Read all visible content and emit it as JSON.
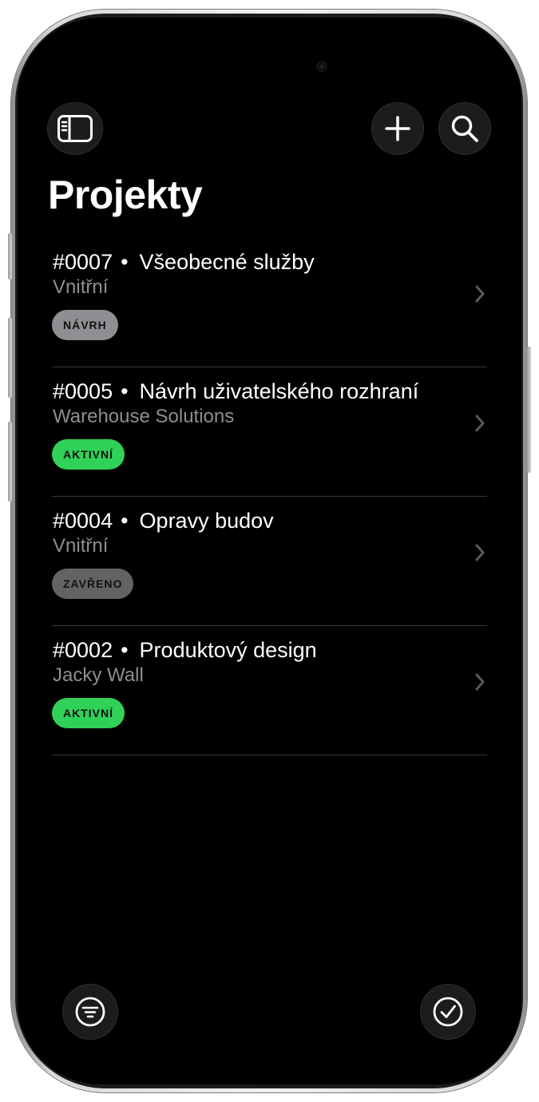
{
  "header": {
    "title": "Projekty",
    "icons": {
      "sidebar": "sidebar-icon",
      "add": "plus-icon",
      "search": "search-icon"
    }
  },
  "projects": [
    {
      "number": "#0007",
      "separator": "•",
      "name": "Všeobecné služby",
      "client": "Vnitřní",
      "status": "NÁVRH",
      "status_color": "#8e8e93"
    },
    {
      "number": "#0005",
      "separator": "•",
      "name": "Návrh uživatelského rozhraní",
      "client": "Warehouse Solutions",
      "status": "AKTIVNÍ",
      "status_color": "#30d158"
    },
    {
      "number": "#0004",
      "separator": "•",
      "name": "Opravy budov",
      "client": "Vnitřní",
      "status": "ZAVŘENO",
      "status_color": "#636366"
    },
    {
      "number": "#0002",
      "separator": "•",
      "name": "Produktový design",
      "client": "Jacky Wall",
      "status": "AKTIVNÍ",
      "status_color": "#30d158"
    }
  ],
  "toolbar": {
    "icons": {
      "filter": "filter-icon",
      "select": "checkmark-circle-icon"
    }
  },
  "colors": {
    "background": "#000000",
    "text_primary": "#ffffff",
    "text_secondary": "#8e8e93",
    "separator": "#38383a",
    "button_bg": "#1c1c1e"
  }
}
